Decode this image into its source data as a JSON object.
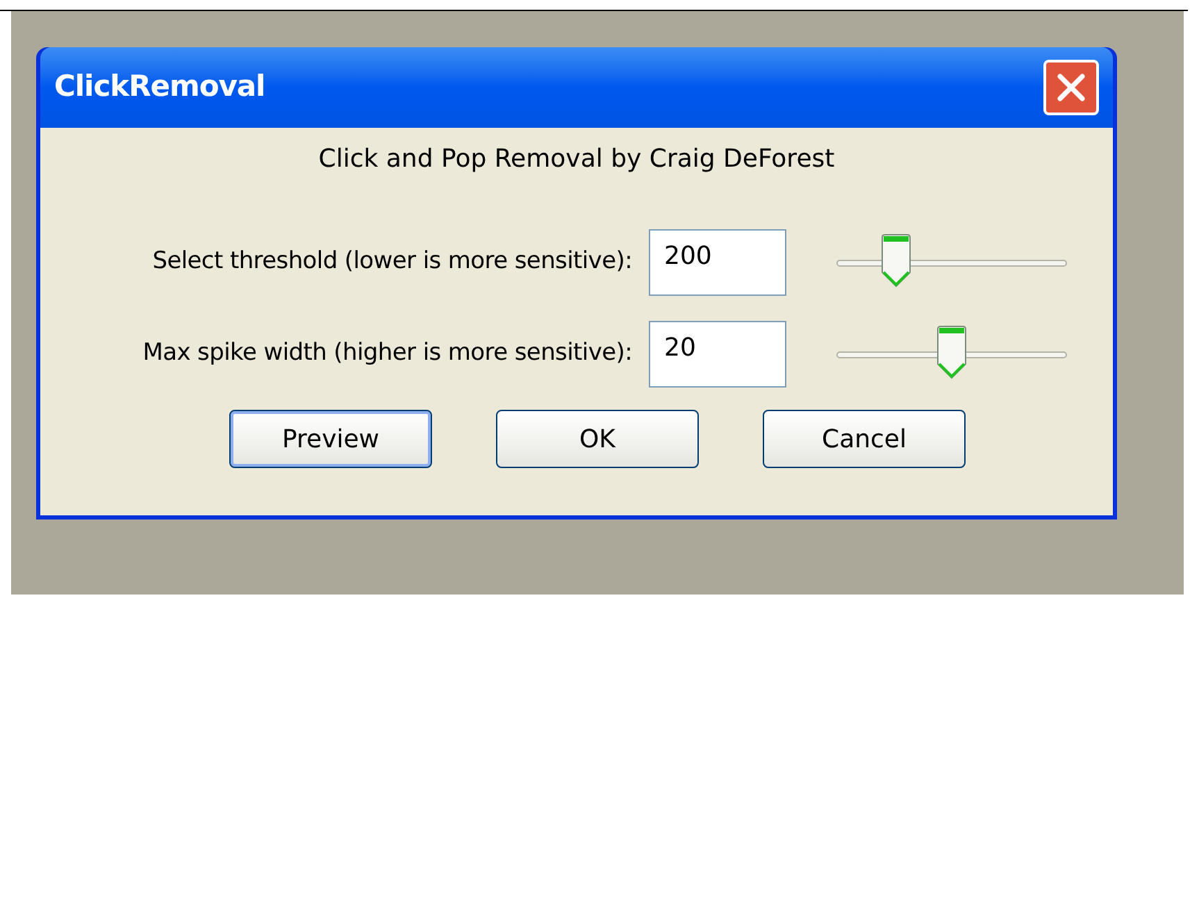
{
  "window": {
    "title": "ClickRemoval"
  },
  "heading": "Click and Pop Removal by Craig DeForest",
  "fields": [
    {
      "label": "Select threshold (lower is more sensitive):",
      "value": "200",
      "level": 0.26
    },
    {
      "label": "Max spike width (higher is more sensitive):",
      "value": "20",
      "level": 0.5
    }
  ],
  "buttons": [
    {
      "label": "Preview",
      "default": true
    },
    {
      "label": "OK",
      "default": false
    },
    {
      "label": "Cancel",
      "default": false
    }
  ]
}
